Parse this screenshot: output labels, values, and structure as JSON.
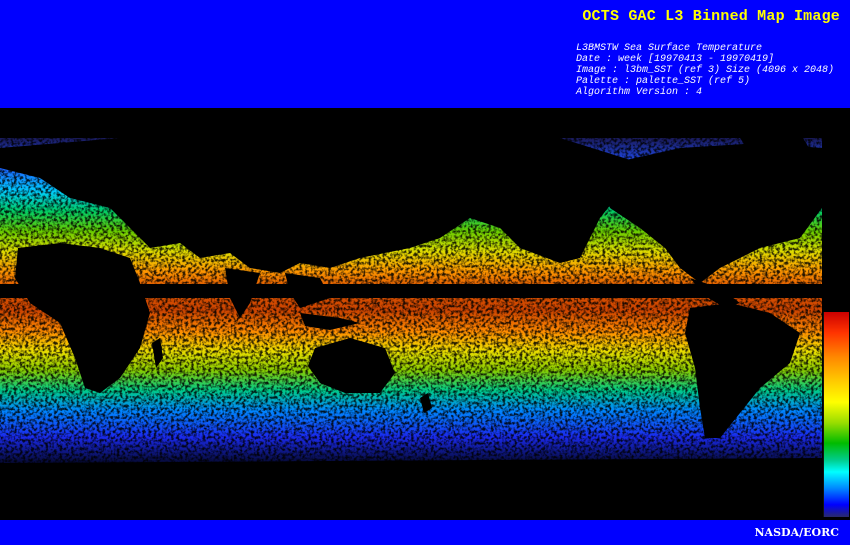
{
  "header": {
    "title": "OCTS GAC L3 Binned Map Image",
    "meta_lines": [
      "L3BMSTW Sea Surface Temperature",
      "Date : week [19970413 - 19970419]",
      "Image : l3bm_SST (ref 3) Size (4096 x 2048)",
      "Palette : palette_SST (ref 5)",
      "Algorithm Version : 4"
    ]
  },
  "footer": {
    "credit": "NASDA/EORC"
  },
  "map": {
    "type": "sea-surface-temperature-map",
    "projection": "equirectangular",
    "land_color": "#000000"
  },
  "colors": {
    "banner": "#0000ff",
    "title": "#ffff00",
    "text": "#ffffff",
    "background": "#000000"
  },
  "colorbar": {
    "scale": [
      "#cc0000",
      "#ff8800",
      "#ffff00",
      "#00bb00",
      "#00ffff",
      "#0000ff",
      "#2a2a6a"
    ],
    "direction": "warm-top"
  }
}
